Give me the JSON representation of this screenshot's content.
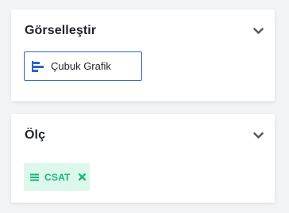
{
  "visualize": {
    "title": "Görselleştir",
    "chart_option": {
      "label": "Çubuk Grafik",
      "icon": "bar-chart-icon"
    },
    "collapse_icon": "chevron-down-icon"
  },
  "measure": {
    "title": "Ölç",
    "collapse_icon": "chevron-down-icon",
    "tags": [
      {
        "label": "CSAT",
        "drag_icon": "drag-handle-icon",
        "remove_icon": "close-icon"
      }
    ]
  },
  "colors": {
    "accent_blue": "#2f64c8",
    "tag_bg": "#dcf7ec",
    "tag_text": "#17b575"
  }
}
